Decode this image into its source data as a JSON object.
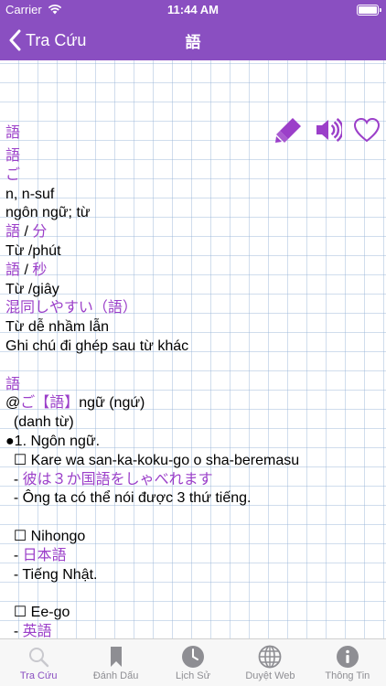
{
  "status_bar": {
    "carrier": "Carrier",
    "time": "11:44 AM"
  },
  "nav": {
    "back_label": "Tra Cứu",
    "title": "語"
  },
  "entry": {
    "headword": "語",
    "lines": [
      {
        "text": "語",
        "style": "purple"
      },
      {
        "text": "ご",
        "style": "purple"
      },
      {
        "text": "n, n-suf",
        "style": "black"
      },
      {
        "text": "ngôn ngữ; từ",
        "style": "black"
      },
      {
        "parts": [
          {
            "text": "語",
            "style": "purple"
          },
          {
            "text": " / ",
            "style": "black"
          },
          {
            "text": "分",
            "style": "purple"
          }
        ]
      },
      {
        "text": "Từ /phút",
        "style": "black"
      },
      {
        "parts": [
          {
            "text": "語",
            "style": "purple"
          },
          {
            "text": " / ",
            "style": "black"
          },
          {
            "text": "秒",
            "style": "purple"
          }
        ]
      },
      {
        "text": "Từ /giây",
        "style": "black"
      },
      {
        "text": "混同しやすい（語）",
        "style": "purple"
      },
      {
        "text": "Từ dễ nhầm lẫn",
        "style": "black"
      },
      {
        "text": "Ghi chú đi ghép sau từ khác",
        "style": "black"
      },
      {
        "text": "",
        "style": "blank"
      },
      {
        "text": "語",
        "style": "purple"
      },
      {
        "parts": [
          {
            "text": "@",
            "style": "black"
          },
          {
            "text": "ご【語】",
            "style": "purple"
          },
          {
            "text": "ngữ (ngứ)",
            "style": "black"
          }
        ]
      },
      {
        "text": "  (danh từ)",
        "style": "black"
      },
      {
        "text": "●1. Ngôn ngữ.",
        "style": "black"
      },
      {
        "text": "  ☐ Kare wa san-ka-koku-go o sha-beremasu",
        "style": "black"
      },
      {
        "parts": [
          {
            "text": "  - ",
            "style": "black"
          },
          {
            "text": "彼は３か国語をしゃべれます",
            "style": "purple"
          }
        ]
      },
      {
        "text": "  - Ông ta có thể nói được 3 thứ tiếng.",
        "style": "black"
      },
      {
        "text": "",
        "style": "blank"
      },
      {
        "text": "  ☐ Nihongo",
        "style": "black"
      },
      {
        "parts": [
          {
            "text": "  - ",
            "style": "black"
          },
          {
            "text": "日本語",
            "style": "purple"
          }
        ]
      },
      {
        "text": "  - Tiếng Nhật.",
        "style": "black"
      },
      {
        "text": "",
        "style": "blank"
      },
      {
        "text": "  ☐ Ee-go",
        "style": "black"
      },
      {
        "parts": [
          {
            "text": "  - ",
            "style": "black"
          },
          {
            "text": "英語",
            "style": "purple"
          }
        ]
      }
    ]
  },
  "actions": [
    {
      "name": "highlighter-icon",
      "label": "highlight"
    },
    {
      "name": "speaker-icon",
      "label": "pronounce"
    },
    {
      "name": "heart-icon",
      "label": "favorite"
    }
  ],
  "tabs": [
    {
      "name": "tab-tra-cuu",
      "label": "Tra Cứu",
      "icon": "search-icon",
      "active": true
    },
    {
      "name": "tab-danh-dau",
      "label": "Đánh Dấu",
      "icon": "bookmark-icon",
      "active": false
    },
    {
      "name": "tab-lich-su",
      "label": "Lịch Sử",
      "icon": "clock-icon",
      "active": false
    },
    {
      "name": "tab-duyet-web",
      "label": "Duyệt Web",
      "icon": "globe-icon",
      "active": false
    },
    {
      "name": "tab-thong-tin",
      "label": "Thông Tin",
      "icon": "info-icon",
      "active": false
    }
  ],
  "colors": {
    "accent": "#8a4fc1",
    "word_purple": "#9b3fc9",
    "tab_inactive": "#8e8e93"
  }
}
